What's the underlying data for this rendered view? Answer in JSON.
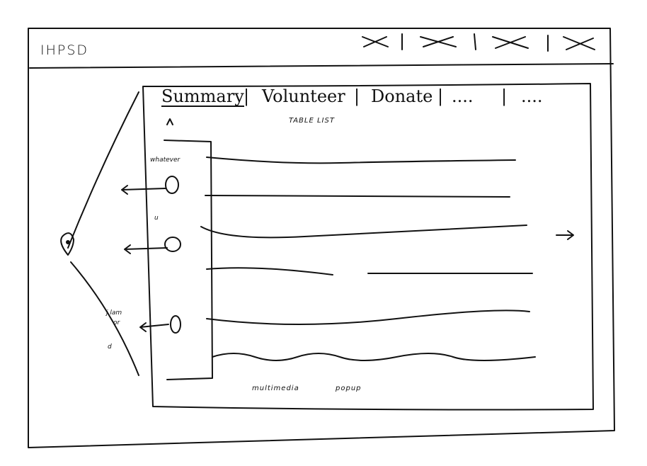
{
  "app": {
    "logo": "IHPSD"
  },
  "window_controls": [
    {
      "name": "control-1",
      "glyph": "×"
    },
    {
      "name": "control-2",
      "glyph": "×"
    },
    {
      "name": "control-3",
      "glyph": "×"
    },
    {
      "name": "control-4",
      "glyph": "×"
    }
  ],
  "tabs": [
    {
      "label": "Summary",
      "active": true
    },
    {
      "label": "Volunteer",
      "active": false
    },
    {
      "label": "Donate",
      "active": false
    },
    {
      "label": "....",
      "active": false
    },
    {
      "label": "....",
      "active": false
    }
  ],
  "tab_separator": "|",
  "main": {
    "table_label": "TABLE LIST",
    "caret": "^",
    "next_arrow": "→",
    "bottom_notes": [
      "multimedia",
      "popup"
    ]
  },
  "side_panel": {
    "labels": [
      "whatever",
      "u",
      "j.lam",
      "or",
      "d"
    ],
    "pin_icon": "map-pin"
  },
  "colors": {
    "ink": "#111111",
    "paper": "#ffffff"
  }
}
